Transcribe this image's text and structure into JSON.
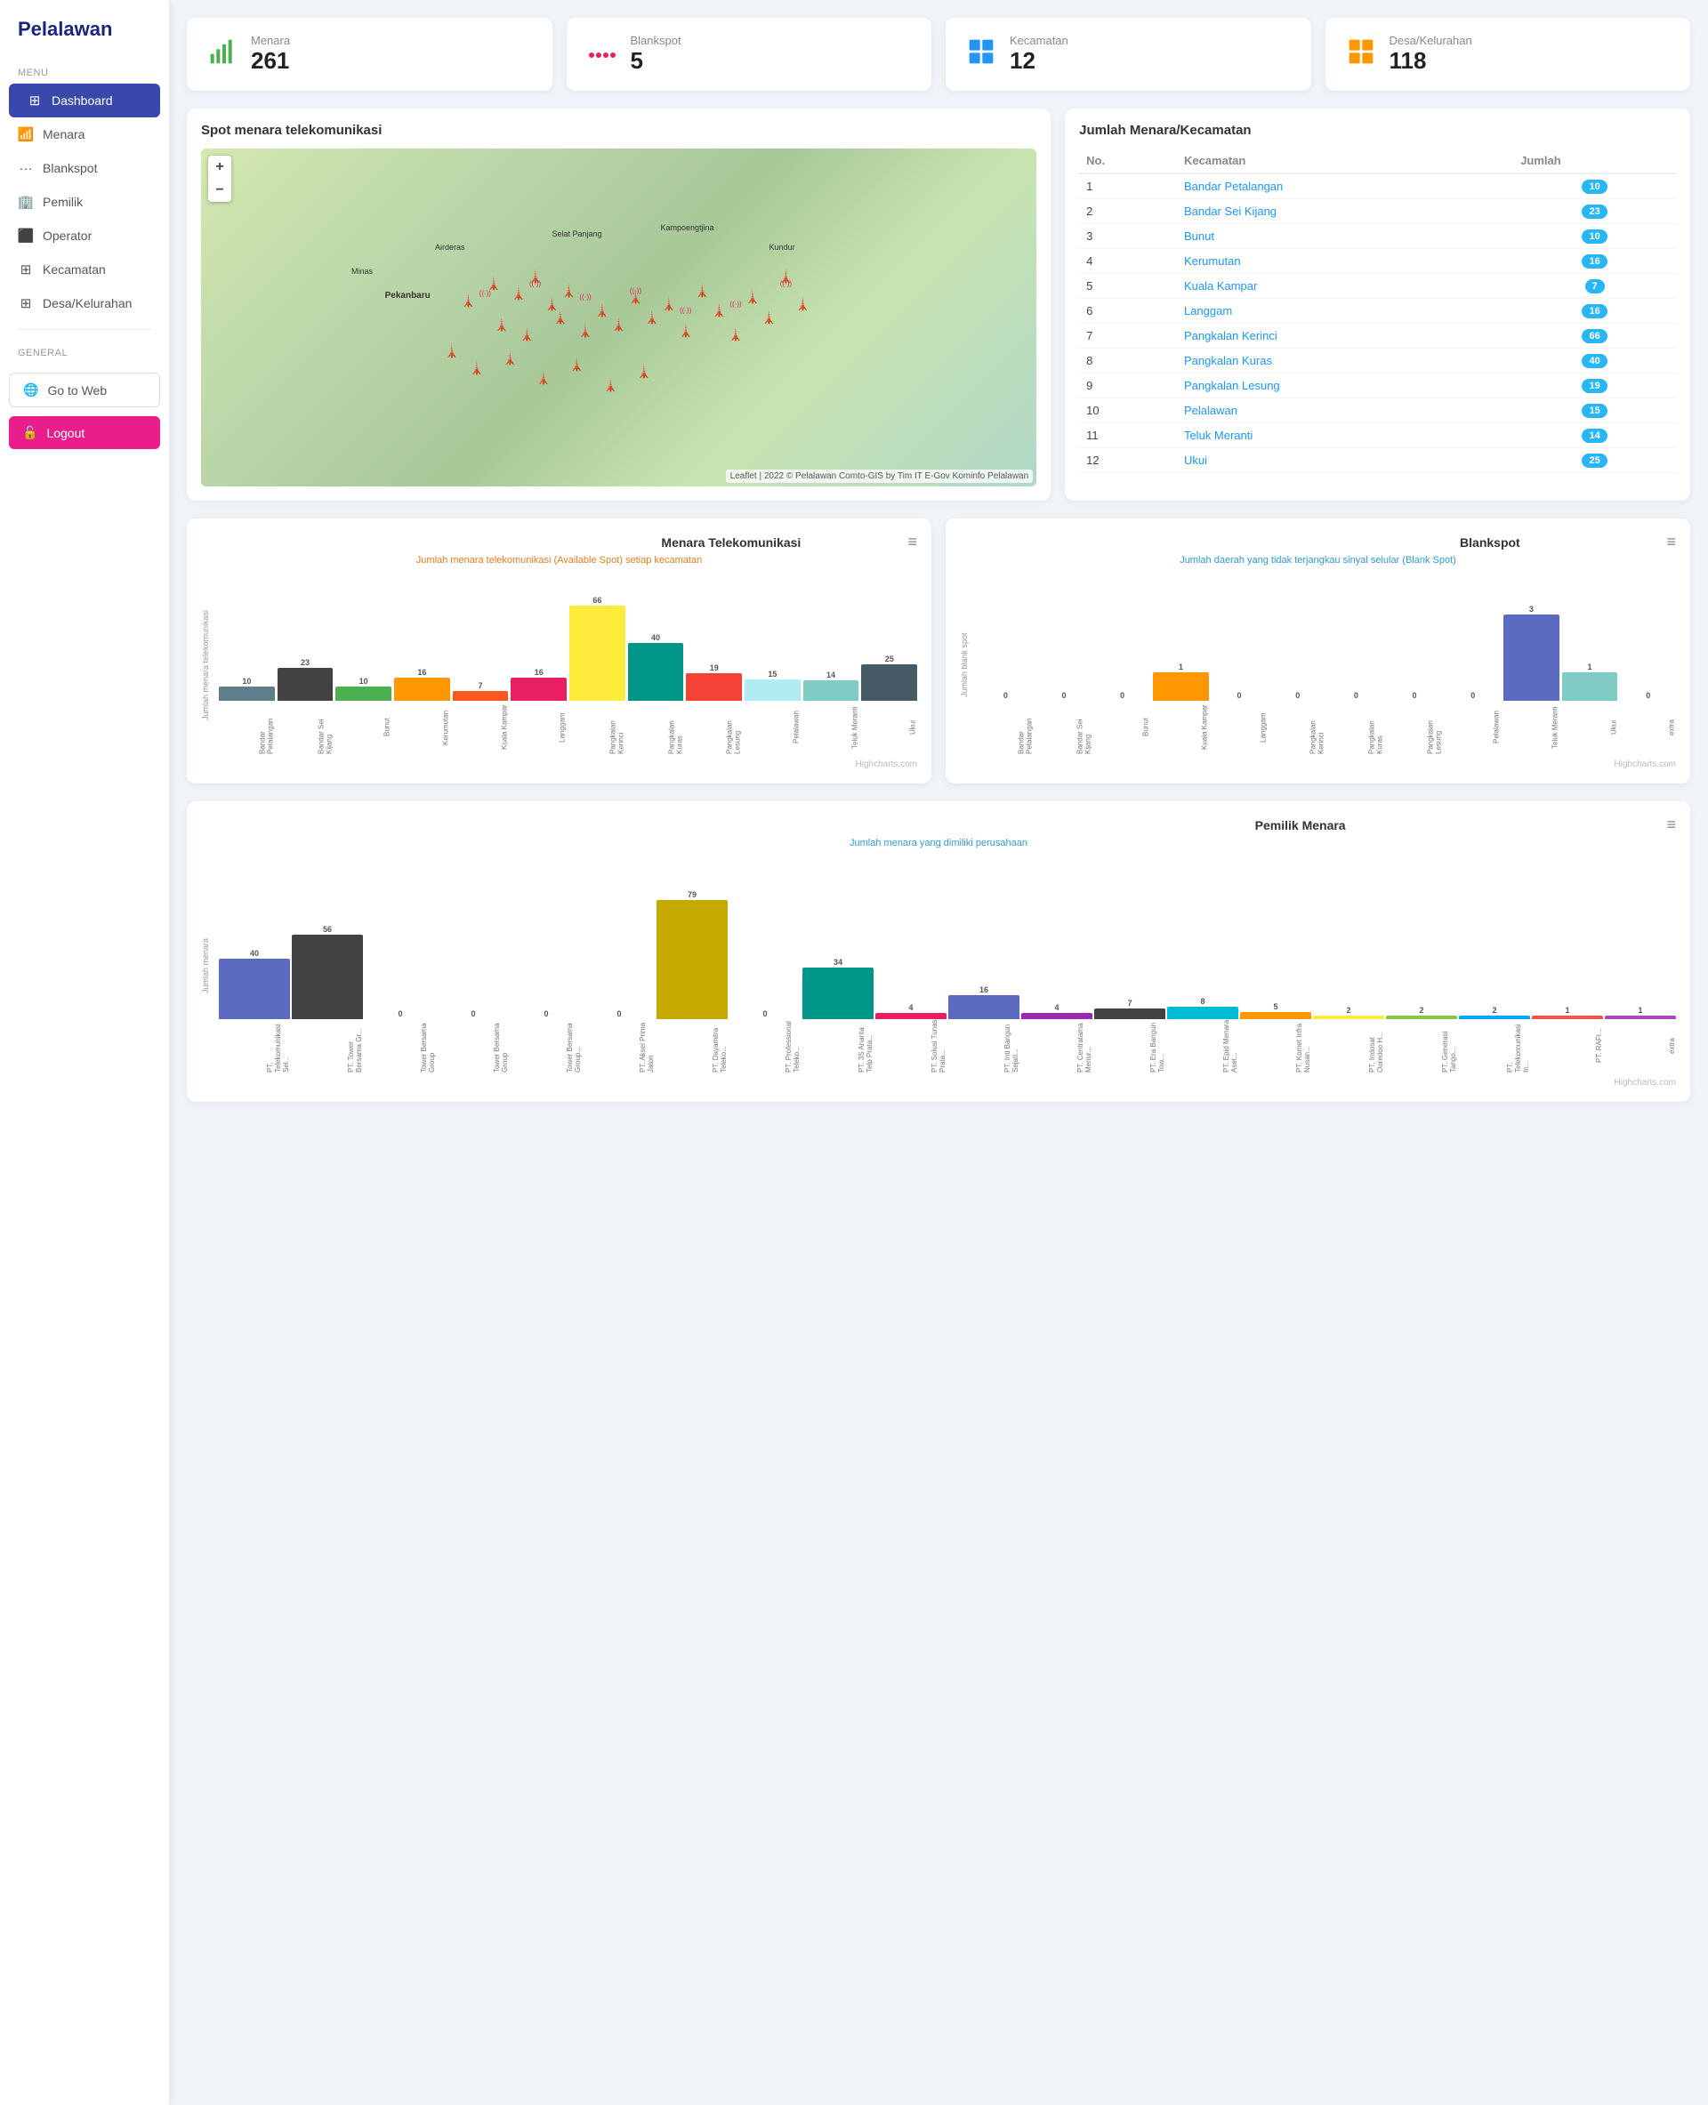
{
  "app": {
    "title": "Pelalawan"
  },
  "sidebar": {
    "menu_label": "Menu",
    "general_label": "General",
    "items": [
      {
        "id": "dashboard",
        "label": "Dashboard",
        "icon": "⊞",
        "active": true
      },
      {
        "id": "menara",
        "label": "Menara",
        "icon": "📶"
      },
      {
        "id": "blankspot",
        "label": "Blankspot",
        "icon": "···"
      },
      {
        "id": "pemilik",
        "label": "Pemilik",
        "icon": "🏢"
      },
      {
        "id": "operator",
        "label": "Operator",
        "icon": "⬛"
      },
      {
        "id": "kecamatan",
        "label": "Kecamatan",
        "icon": "⊞"
      },
      {
        "id": "desa",
        "label": "Desa/Kelurahan",
        "icon": "⊞"
      }
    ],
    "goto_label": "Go to Web",
    "logout_label": "Logout"
  },
  "stats": [
    {
      "id": "menara",
      "label": "Menara",
      "value": "261",
      "color": "#4caf50",
      "icon": "📶"
    },
    {
      "id": "blankspot",
      "label": "Blankspot",
      "value": "5",
      "color": "#e91e63",
      "icon": "···"
    },
    {
      "id": "kecamatan",
      "label": "Kecamatan",
      "value": "12",
      "color": "#2196f3",
      "icon": "⊞"
    },
    {
      "id": "desa",
      "label": "Desa/Kelurahan",
      "value": "118",
      "color": "#ff9800",
      "icon": "⊞"
    }
  ],
  "map": {
    "title": "Spot menara telekomunikasi",
    "credit": "Leaflet | 2022 © Pelalawan Comto-GIS by Tim IT E-Gov Kominfo Pelalawan"
  },
  "kecamatan_table": {
    "title": "Jumlah Menara/Kecamatan",
    "headers": [
      "No.",
      "Kecamatan",
      "Jumlah"
    ],
    "rows": [
      {
        "no": 1,
        "name": "Bandar Petalangan",
        "count": 10
      },
      {
        "no": 2,
        "name": "Bandar Sei Kijang",
        "count": 23
      },
      {
        "no": 3,
        "name": "Bunut",
        "count": 10
      },
      {
        "no": 4,
        "name": "Kerumutan",
        "count": 16
      },
      {
        "no": 5,
        "name": "Kuala Kampar",
        "count": 7
      },
      {
        "no": 6,
        "name": "Langgam",
        "count": 16
      },
      {
        "no": 7,
        "name": "Pangkalan Kerinci",
        "count": 66
      },
      {
        "no": 8,
        "name": "Pangkalan Kuras",
        "count": 40
      },
      {
        "no": 9,
        "name": "Pangkalan Lesung",
        "count": 19
      },
      {
        "no": 10,
        "name": "Pelalawan",
        "count": 15
      },
      {
        "no": 11,
        "name": "Teluk Meranti",
        "count": 14
      },
      {
        "no": 12,
        "name": "Ukui",
        "count": 25
      }
    ]
  },
  "chart_menara": {
    "title": "Menara Telekomunikasi",
    "subtitle": "Jumlah menara telekomunikasi (Available Spot) setiap kecamatan",
    "y_label": "Jumlah menara telekomunikasi",
    "footer": "Highcharts.com",
    "data": [
      {
        "label": "Bandar Petalangan",
        "value": 10,
        "color": "#607d8b"
      },
      {
        "label": "Bandar Sei Kijang",
        "value": 23,
        "color": "#424242"
      },
      {
        "label": "Bunut",
        "value": 10,
        "color": "#4caf50"
      },
      {
        "label": "Kerumutan",
        "value": 16,
        "color": "#ff9800"
      },
      {
        "label": "Kuala Kampar",
        "value": 7,
        "color": "#ff5722"
      },
      {
        "label": "Langgam",
        "value": 16,
        "color": "#e91e63"
      },
      {
        "label": "Pangkalan Kerinci",
        "value": 66,
        "color": "#ffeb3b"
      },
      {
        "label": "Pangkalan Kuras",
        "value": 40,
        "color": "#009688"
      },
      {
        "label": "Pangkalan Lesung",
        "value": 19,
        "color": "#f44336"
      },
      {
        "label": "Pelalawan",
        "value": 15,
        "color": "#b2ebf2"
      },
      {
        "label": "Teluk Meranti",
        "value": 14,
        "color": "#80cbc4"
      },
      {
        "label": "Ukui",
        "value": 25,
        "color": "#455a64"
      }
    ],
    "max": 80
  },
  "chart_blankspot": {
    "title": "Blankspot",
    "subtitle": "Jumlah daerah yang tidak terjangkau sinyal selular (Blank Spot)",
    "y_label": "Jumlah blank spot",
    "footer": "Highcharts.com",
    "data": [
      {
        "label": "Bandar Petalangan",
        "value": 0,
        "color": "#607d8b"
      },
      {
        "label": "Bandar Sei Kijang",
        "value": 0,
        "color": "#424242"
      },
      {
        "label": "Bunut",
        "value": 0,
        "color": "#4caf50"
      },
      {
        "label": "Kuala Kampar",
        "value": 1,
        "color": "#ff9800"
      },
      {
        "label": "Langgam",
        "value": 0,
        "color": "#ff5722"
      },
      {
        "label": "Pangkalan Kerinci",
        "value": 0,
        "color": "#e91e63"
      },
      {
        "label": "Pangkalan Kuras",
        "value": 0,
        "color": "#ffeb3b"
      },
      {
        "label": "Pangkalan Lesung",
        "value": 0,
        "color": "#009688"
      },
      {
        "label": "Pelalawan",
        "value": 0,
        "color": "#f44336"
      },
      {
        "label": "Teluk Meranti",
        "value": 3,
        "color": "#5c6bc0"
      },
      {
        "label": "Ukui",
        "value": 1,
        "color": "#80cbc4"
      },
      {
        "label": "extra",
        "value": 0,
        "color": "#455a64"
      }
    ],
    "max": 4
  },
  "chart_pemilik": {
    "title": "Pemilik Menara",
    "subtitle": "Jumlah menara yang dimiliki perusahaan",
    "y_label": "Jumlah menara",
    "footer": "Highcharts.com",
    "data": [
      {
        "label": "PT. Telekomunikasi Sel...",
        "value": 40,
        "color": "#5c6bc0"
      },
      {
        "label": "PT. Tower Bersama Gr...",
        "value": 56,
        "color": "#424242"
      },
      {
        "label": "Tower Bersama Group",
        "value": 0,
        "color": "#607d8b"
      },
      {
        "label": "Tower Bersama Group",
        "value": 0,
        "color": "#78909c"
      },
      {
        "label": "Tower Bersama Group...",
        "value": 0,
        "color": "#90a4ae"
      },
      {
        "label": "PT. Aksel Prima Jaton",
        "value": 0,
        "color": "#b0bec5"
      },
      {
        "label": "PT. Dayamitra Teleko...",
        "value": 79,
        "color": "#c5a800"
      },
      {
        "label": "PT. Professional Teleko...",
        "value": 0,
        "color": "#f44336"
      },
      {
        "label": "PT. 3S Ananta Telp Prata...",
        "value": 34,
        "color": "#009688"
      },
      {
        "label": "PT. Solusi Tunas Prata...",
        "value": 4,
        "color": "#e91e63"
      },
      {
        "label": "PT. Inti Bangun Sejati...",
        "value": 16,
        "color": "#5c6bc0"
      },
      {
        "label": "PT. Centratama Menur...",
        "value": 4,
        "color": "#9c27b0"
      },
      {
        "label": "PT. Era Bangun Tow...",
        "value": 7,
        "color": "#424242"
      },
      {
        "label": "PT. Epid Menara Aset...",
        "value": 8,
        "color": "#00bcd4"
      },
      {
        "label": "PT. Komet Infra Nusan...",
        "value": 5,
        "color": "#ff9800"
      },
      {
        "label": "PT. Indosat Ooredoo H...",
        "value": 2,
        "color": "#ffeb3b"
      },
      {
        "label": "PT. Generasi Tango...",
        "value": 2,
        "color": "#8bc34a"
      },
      {
        "label": "PT. Telekomunikasi In...",
        "value": 2,
        "color": "#03a9f4"
      },
      {
        "label": "PT. RAFI...",
        "value": 1,
        "color": "#ef5350"
      },
      {
        "label": "extra",
        "value": 1,
        "color": "#ab47bc"
      }
    ],
    "max": 100
  }
}
